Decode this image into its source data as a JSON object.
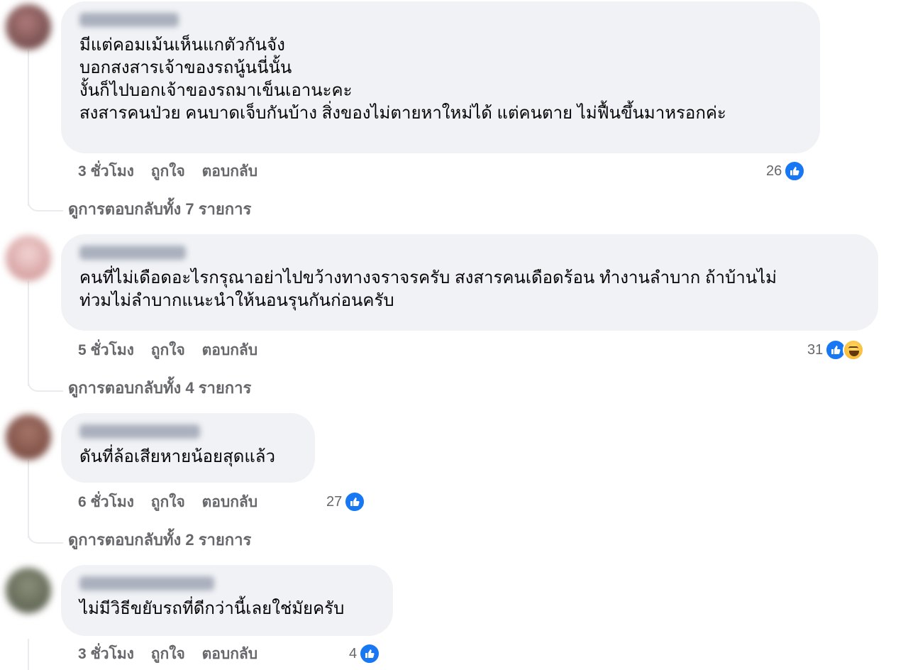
{
  "comments": [
    {
      "lines": [
        "มีแต่คอมเม้นเห็นแกตัวกันจัง",
        "บอกสงสารเจ้าของรถนู้นนี่นั้น",
        "งั้นก็ไปบอกเจ้าของรถมาเข็นเอานะคะ",
        "สงสารคนป่วย คนบาดเจ็บกันบ้าง สิ่งของไม่ตายหาใหม่ได้ แต่คนตาย ไม่ฟื้นขึ้นมาหรอกค่ะ"
      ],
      "time": "3 ชั่วโมง",
      "like_label": "ถูกใจ",
      "reply_label": "ตอบกลับ",
      "reaction_count": "26",
      "view_replies": "ดูการตอบกลับทั้ง 7 รายการ"
    },
    {
      "lines": [
        "คนที่ไม่เดือดอะไรกรุณาอย่าไปขว้างทางจราจรครับ สงสารคนเดือดร้อน ทำงานลำบาก ถ้าบ้านไม่",
        "ท่วมไม่ลำบากแนะนำให้นอนรุนกันก่อนครับ"
      ],
      "time": "5 ชั่วโมง",
      "like_label": "ถูกใจ",
      "reply_label": "ตอบกลับ",
      "reaction_count": "31",
      "view_replies": "ดูการตอบกลับทั้ง 4 รายการ"
    },
    {
      "lines": [
        "ดันที่ล้อเสียหายน้อยสุดแล้ว"
      ],
      "time": "6 ชั่วโมง",
      "like_label": "ถูกใจ",
      "reply_label": "ตอบกลับ",
      "reaction_count": "27",
      "view_replies": "ดูการตอบกลับทั้ง 2 รายการ"
    },
    {
      "lines": [
        "ไม่มีวิธีขยับรถที่ดีกว่านี้เลยใช่มัยครับ"
      ],
      "time": "3 ชั่วโมง",
      "like_label": "ถูกใจ",
      "reply_label": "ตอบกลับ",
      "reaction_count": "4"
    }
  ],
  "icons": {
    "like": "like-reaction-icon",
    "haha": "haha-reaction-icon"
  },
  "colors": {
    "bubble": "#f0f2f5",
    "meta_text": "#65676b",
    "like_blue": "#1877f2"
  }
}
